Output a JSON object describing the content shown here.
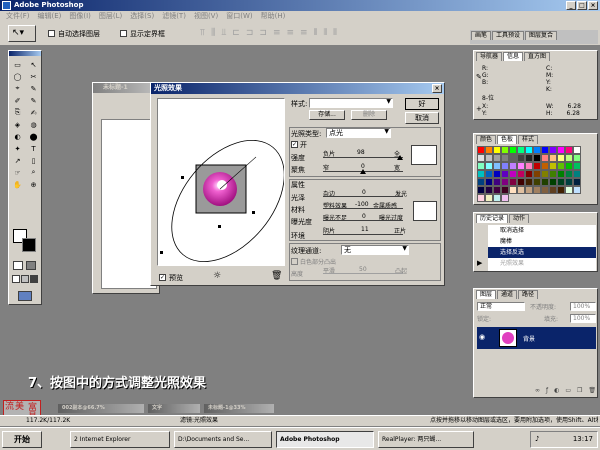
{
  "app": {
    "title": "Adobe Photoshop",
    "menu": [
      "文件(F)",
      "编辑(E)",
      "图像(I)",
      "图层(L)",
      "选择(S)",
      "滤镜(T)",
      "视图(V)",
      "窗口(W)",
      "帮助(H)"
    ]
  },
  "options": {
    "auto_select": "自动选择图层",
    "show_bounds": "显示定界框"
  },
  "palette_well": {
    "tabs": [
      "画笔",
      "工具预设",
      "图层复合"
    ]
  },
  "doc_window": {
    "title": "未标题-1"
  },
  "dialog": {
    "title": "光照效果",
    "style_label": "样式:",
    "save": "存储...",
    "delete": "删除",
    "ok": "好",
    "cancel": "取消",
    "light_type_label": "光照类型:",
    "light_type_value": "点光",
    "on_label": "开",
    "intensity_label": "强度",
    "intensity_left": "负片",
    "intensity_value": "98",
    "intensity_right": "全",
    "focus_label": "聚焦",
    "focus_left": "窄",
    "focus_value": "0",
    "focus_right": "宽",
    "props_label": "属性",
    "gloss_label": "光泽",
    "gloss_left": "杂边",
    "gloss_value": "0",
    "gloss_right": "发光",
    "material_label": "材料",
    "material_left": "塑料效果",
    "material_value": "-100",
    "material_right": "金属质感",
    "exposure_label": "曝光度",
    "exposure_left": "曝光不足",
    "exposure_value": "0",
    "exposure_right": "曝光过度",
    "ambience_label": "环境",
    "ambience_left": "阴片",
    "ambience_value": "11",
    "ambience_right": "正片",
    "texture_label": "纹理通道:",
    "texture_value": "无",
    "white_high": "白色部分凸出",
    "height_label": "高度",
    "height_left": "平滑",
    "height_mid": "50",
    "height_right": "凸起",
    "preview_label": "预览"
  },
  "navigator": {
    "tabs": [
      "导航器",
      "信息",
      "直方图"
    ],
    "r": "R:",
    "g": "G:",
    "b": "B:",
    "c": "C:",
    "m": "M:",
    "y": "Y:",
    "k": "K:",
    "x": "X:",
    "yy": "Y:",
    "w": "W:",
    "h": "H:",
    "w_val": "6.28",
    "h_val": "6.28",
    "pct": "8-位"
  },
  "swatches": {
    "tabs": [
      "颜色",
      "色板",
      "样式"
    ],
    "colors": [
      "#ff0000",
      "#ff8000",
      "#ffff00",
      "#80ff00",
      "#00ff00",
      "#00ff80",
      "#00ffff",
      "#0080ff",
      "#0000ff",
      "#8000ff",
      "#ff00ff",
      "#ff0080",
      "#ffffff",
      "#e0e0e0",
      "#c0c0c0",
      "#a0a0a0",
      "#808080",
      "#606060",
      "#404040",
      "#202020",
      "#000000",
      "#ff8080",
      "#ffc080",
      "#ffff80",
      "#c0ff80",
      "#80ff80",
      "#80ffc0",
      "#80ffff",
      "#80c0ff",
      "#8080ff",
      "#c080ff",
      "#ff80ff",
      "#ff80c0",
      "#c00000",
      "#c06000",
      "#c0c000",
      "#60c000",
      "#00c000",
      "#00c060",
      "#00c0c0",
      "#0060c0",
      "#0000c0",
      "#6000c0",
      "#c000c0",
      "#c00060",
      "#800000",
      "#804000",
      "#808000",
      "#408000",
      "#008000",
      "#008040",
      "#008080",
      "#004080",
      "#000080",
      "#400080",
      "#800080",
      "#800040",
      "#400000",
      "#402000",
      "#404000",
      "#204000",
      "#004000",
      "#004020",
      "#004040",
      "#002040",
      "#000040",
      "#200040",
      "#400040",
      "#400020",
      "#ffe0c0",
      "#e0c0a0",
      "#c0a080",
      "#a08060",
      "#806040",
      "#604020",
      "#402000",
      "#e0ffe0",
      "#c0e0ff",
      "#ffd0e0",
      "#f0f0c0",
      "#c0f0f0",
      "#f0c0f0"
    ]
  },
  "history": {
    "tabs": [
      "历史记录",
      "动作"
    ],
    "items": [
      "取消选择",
      "魔棒",
      "选择反选",
      "光照效果"
    ]
  },
  "layers": {
    "tabs": [
      "图层",
      "通道",
      "路径"
    ],
    "mode": "正常",
    "opacity_label": "不透明度:",
    "opacity": "100%",
    "lock_label": "锁定:",
    "fill_label": "填充:",
    "fill": "100%",
    "layer_name": "背景"
  },
  "caption": "7、按图中的方式调整光照效果",
  "watermark": [
    "富昌",
    "美",
    "流"
  ],
  "status": {
    "zoom": "117.2K/117.2K",
    "filter": "滤镜:光照效果",
    "hint": "点按并拖移以移动图层或选区，要用附加选项，使用Shift、Alt和Ctrl键。"
  },
  "minimized": [
    "002副本@66.7%",
    "文字",
    "未标题-1@33%"
  ],
  "taskbar": {
    "start": "开始",
    "items": [
      "2 Internet Explorer",
      "D:\\Documents and Se...",
      "Adobe Photoshop",
      "RealPlayer: 两只蝴..."
    ],
    "time": "13:17"
  },
  "accent": "#0a246a",
  "pink": "#e040c0"
}
